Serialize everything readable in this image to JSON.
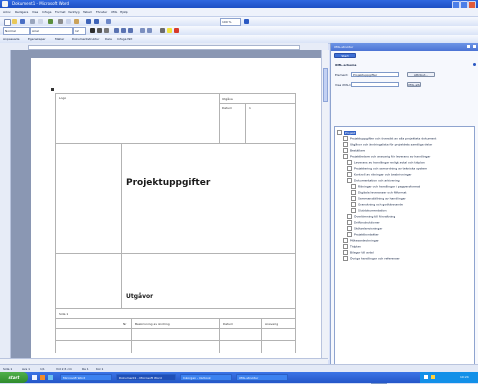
{
  "window": {
    "title": "Dokument1 - Microsoft Word"
  },
  "menu": [
    "Arkiv",
    "Redigera",
    "Visa",
    "Infoga",
    "Format",
    "Verktyg",
    "Tabell",
    "Fönster",
    "XML",
    "Hjälp"
  ],
  "toolbar": {
    "style_value": "Normal",
    "font_value": "Arial",
    "size_value": "12",
    "zoom_value": "100 %",
    "row3_labels": [
      "Anpassade",
      "Egenskaper",
      "Mallar",
      "Dokumentstruktur",
      "Dela",
      "Infoga fält"
    ]
  },
  "icons": [
    "new-icon",
    "open-icon",
    "save-icon",
    "print-icon",
    "preview-icon",
    "spelling-icon",
    "cut-icon",
    "copy-icon",
    "paste-icon",
    "undo-icon",
    "redo-icon",
    "table-icon",
    "bold-icon",
    "italic-icon",
    "underline-icon",
    "align-icon",
    "bullets-icon",
    "indent-icon",
    "border-icon",
    "highlight-icon",
    "font-color-icon"
  ],
  "document": {
    "header_left": "Logo",
    "header_right_1": "Utgåva",
    "header_right_2": "Datum",
    "header_right_value": "1",
    "title": "Projektuppgifter",
    "subtitle": "Utgåvor",
    "footer_label": "Sida 1",
    "footer_cols": [
      "Nr",
      "Beskrivning av ändring",
      "Datum",
      "Ansvarig"
    ]
  },
  "status": {
    "page": "Sida 1",
    "section": "Avs 1",
    "pages": "1/1",
    "position": "Vid 2,5 cm",
    "line": "Ra 1",
    "col": "Kol 1"
  },
  "taskbar": {
    "start": "start",
    "tasks": [
      "Microsoft Word",
      "Dokument1 - Microsoft Word",
      "Inkorgen - Outlook",
      "XML-struktur"
    ],
    "clock": "10:24"
  },
  "pane": {
    "title": "XML-struktur",
    "tab": "Start",
    "section_label": "XML-schema",
    "element_label": "Element:",
    "element_value": "Projektuppgifter",
    "attributes_button": "Attribut...",
    "filter_label": "Visa XML-taggar",
    "options_button": "XML-alternativ",
    "tree_root": "Projekt",
    "tree": [
      "Projektuppgifter och översikt av alla projektets dokument",
      "Utgåvor och ändringslista för projektets samtliga delar",
      "Beställare",
      "Projektledare och ansvarig för leverans av handlingar",
      "Leverans av handlingar enligt avtal och tidplan",
      "Projektering och samordning av tekniska system",
      "Kontroll av ritningar och beskrivningar",
      "Dokumentation och arkivering",
      "Ritningar och handlingar i pappersformat",
      "Digitala leveranser och filformat",
      "Sammanställning av handlingar",
      "Granskning och godkännande",
      "Slutdokumentation",
      "Överlämning till förvaltning",
      "Driftinstruktioner",
      "Skötselanvisningar",
      "Projektkontakter",
      "Mötesanteckningar",
      "Tidplan",
      "Bilagor till avtal",
      "Övriga handlingar och referenser"
    ],
    "footer_left": "Visa alternativ",
    "footer_right": "Skriv ut"
  }
}
